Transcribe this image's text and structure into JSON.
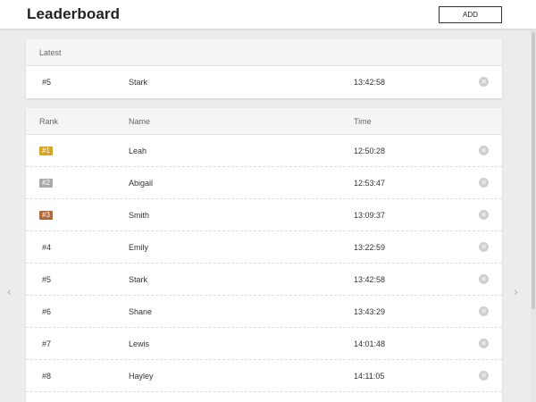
{
  "header": {
    "title": "Leaderboard",
    "add_label": "ADD"
  },
  "latest": {
    "heading": "Latest",
    "entry": {
      "rank": "#5",
      "name": "Stark",
      "time": "13:42:58"
    }
  },
  "board": {
    "columns": {
      "rank": "Rank",
      "name": "Name",
      "time": "Time"
    },
    "rows": [
      {
        "rank": "#1",
        "name": "Leah",
        "time": "12:50:28",
        "badge_color": "#d4a52a"
      },
      {
        "rank": "#2",
        "name": "Abigail",
        "time": "12:53:47",
        "badge_color": "#a9a9a9"
      },
      {
        "rank": "#3",
        "name": "Smith",
        "time": "13:09:37",
        "badge_color": "#b06a3b"
      },
      {
        "rank": "#4",
        "name": "Emily",
        "time": "13:22:59"
      },
      {
        "rank": "#5",
        "name": "Stark",
        "time": "13:42:58"
      },
      {
        "rank": "#6",
        "name": "Shane",
        "time": "13:43:29"
      },
      {
        "rank": "#7",
        "name": "Lewis",
        "time": "14:01:48"
      },
      {
        "rank": "#8",
        "name": "Hayley",
        "time": "14:11:05"
      }
    ]
  },
  "icons": {
    "delete": "close-circle-icon",
    "prev": "chevron-left-icon",
    "next": "chevron-right-icon"
  }
}
